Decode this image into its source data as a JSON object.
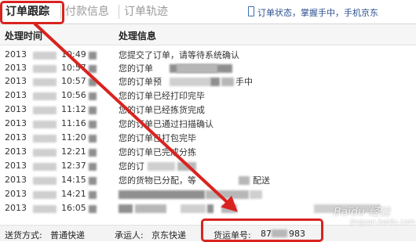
{
  "tabs": [
    {
      "label": "订单跟踪",
      "active": true
    },
    {
      "label": "付款信息",
      "active": false
    },
    {
      "label": "订单轨迹",
      "active": false
    }
  ],
  "promo": {
    "text": "订单状态，掌握手中，手机京东",
    "icon": "mobile-phone-icon"
  },
  "table": {
    "col_time": "处理时间",
    "col_info": "处理信息",
    "rows": [
      {
        "date": "2013",
        "time": "10:49",
        "info": "您提交了订单，请等待系统确认"
      },
      {
        "date": "2013",
        "time": "10:57",
        "info": "您的订单"
      },
      {
        "date": "2013",
        "time": "10:57",
        "info": "您的订单预",
        "info_tail": "手中"
      },
      {
        "date": "2013",
        "time": "10:56",
        "info": "您的订单已经打印完毕"
      },
      {
        "date": "2013",
        "time": "11:12",
        "info": "您的订单已经拣货完成"
      },
      {
        "date": "2013",
        "time": "11:16",
        "info": "您的订单已通过扫描确认"
      },
      {
        "date": "2013",
        "time": "11:20",
        "info": "您的订单已打包完毕"
      },
      {
        "date": "2013",
        "time": "12:21",
        "info": "您的订单已完成分拣"
      },
      {
        "date": "2013",
        "time": "12:37",
        "info": "您的订"
      },
      {
        "date": "2013",
        "time": "14:15",
        "info": "您的货物已分配，等",
        "info_tail": "配送"
      },
      {
        "date": "2013",
        "time": "14:21",
        "info": ""
      },
      {
        "date": "2013",
        "time": "16:05",
        "info": ""
      }
    ]
  },
  "footer": {
    "ship_label": "送货方式:",
    "ship_value": "普通快递",
    "carrier_label": "承运人:",
    "carrier_value": "京东快递",
    "waybill_label": "货运单号:",
    "waybill_prefix": "87",
    "waybill_suffix": "983"
  },
  "watermark": {
    "text": "Baidu 经验",
    "sub": "jingyan.baidu.com"
  },
  "colors": {
    "annotation": "#d9231f",
    "promo": "#2a4f8f"
  }
}
